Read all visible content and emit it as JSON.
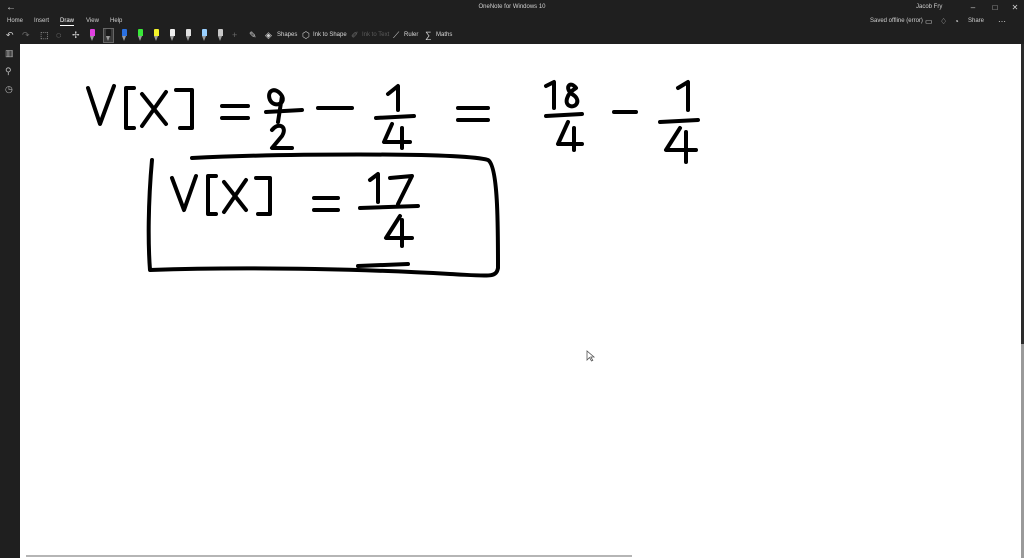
{
  "titlebar": {
    "title": "OneNote for Windows 10",
    "user": "Jacob Fry",
    "back_glyph": "←",
    "forward_glyph": "→",
    "minimize_glyph": "–",
    "maximize_glyph": "□",
    "close_glyph": "✕"
  },
  "menu": {
    "tabs": [
      "Home",
      "Insert",
      "Draw",
      "View",
      "Help"
    ],
    "active_tab": "Draw",
    "sync_status": "Saved offline (error)",
    "share_label": "Share"
  },
  "toolbar": {
    "undo_glyph": "↶",
    "redo_glyph": "↷",
    "shapes_label": "Shapes",
    "ink_to_shape_label": "Ink to Shape",
    "ink_to_text_label": "Ink to Text",
    "ruler_label": "Ruler",
    "maths_label": "Maths",
    "add_pen_glyph": "+",
    "pens": [
      {
        "color": "#e040e0",
        "name": "pen-pink"
      },
      {
        "color": "#1a1a1a",
        "name": "pen-black"
      },
      {
        "color": "#2a70e0",
        "name": "pen-blue"
      },
      {
        "color": "#39e839",
        "name": "pen-green"
      },
      {
        "color": "#f5f52a",
        "name": "highlighter-yellow"
      },
      {
        "color": "#f0f0f0",
        "name": "pen-white"
      },
      {
        "color": "#e0e0e0",
        "name": "pen-silver"
      },
      {
        "color": "#9ad0ff",
        "name": "pen-lightblue"
      },
      {
        "color": "#c8c8c8",
        "name": "pen-gray"
      }
    ],
    "selected_pen": "pen-black"
  },
  "ink": {
    "stroke_color": "#000000",
    "line1": "V[X] = 9/2 − 1/4 = 18/4 − 1/4",
    "line2": "V[X] = 17/4"
  }
}
